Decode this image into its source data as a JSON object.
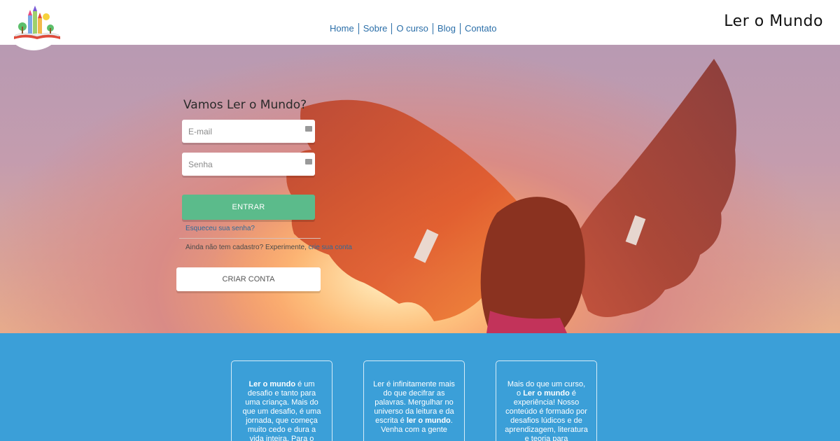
{
  "header": {
    "brand": "Ler o Mundo",
    "nav": [
      {
        "label": "Home"
      },
      {
        "label": "Sobre"
      },
      {
        "label": "O curso"
      },
      {
        "label": "Blog"
      },
      {
        "label": "Contato"
      }
    ]
  },
  "login": {
    "title": "Vamos Ler o Mundo?",
    "email_placeholder": "E-mail",
    "password_placeholder": "Senha",
    "enter_label": "ENTRAR",
    "forgot_label": "Esqueceu sua senha?",
    "signup_hint": "Ainda não tem cadastro? Experimente, ",
    "signup_link": "crie sua conta",
    "create_label": "CRIAR CONTA"
  },
  "cards": [
    {
      "bold_lead": "Ler o mundo",
      "text": " é um desafio e tanto para uma criança. Mais do que um desafio, é uma jornada, que começa muito cedo e dura a vida inteira. Para o"
    },
    {
      "text_before": "Ler é infinitamente mais do que decifrar as palavras. Mergulhar no universo da leitura e da escrita é ",
      "bold_mid": "ler o mundo",
      "text_after": ". Venha com a gente"
    },
    {
      "text_before": "Mais do que um curso, o ",
      "bold_mid": "Ler o mundo",
      "text_after": " é experiência! Nosso conteúdo é formado por desafios lúdicos e de aprendizagem, literatura e teoria para"
    }
  ],
  "colors": {
    "nav_link": "#2a6ea8",
    "enter_button": "#5bbb8b",
    "blue_section": "#3b9fd8",
    "wings": "#c9492c"
  }
}
